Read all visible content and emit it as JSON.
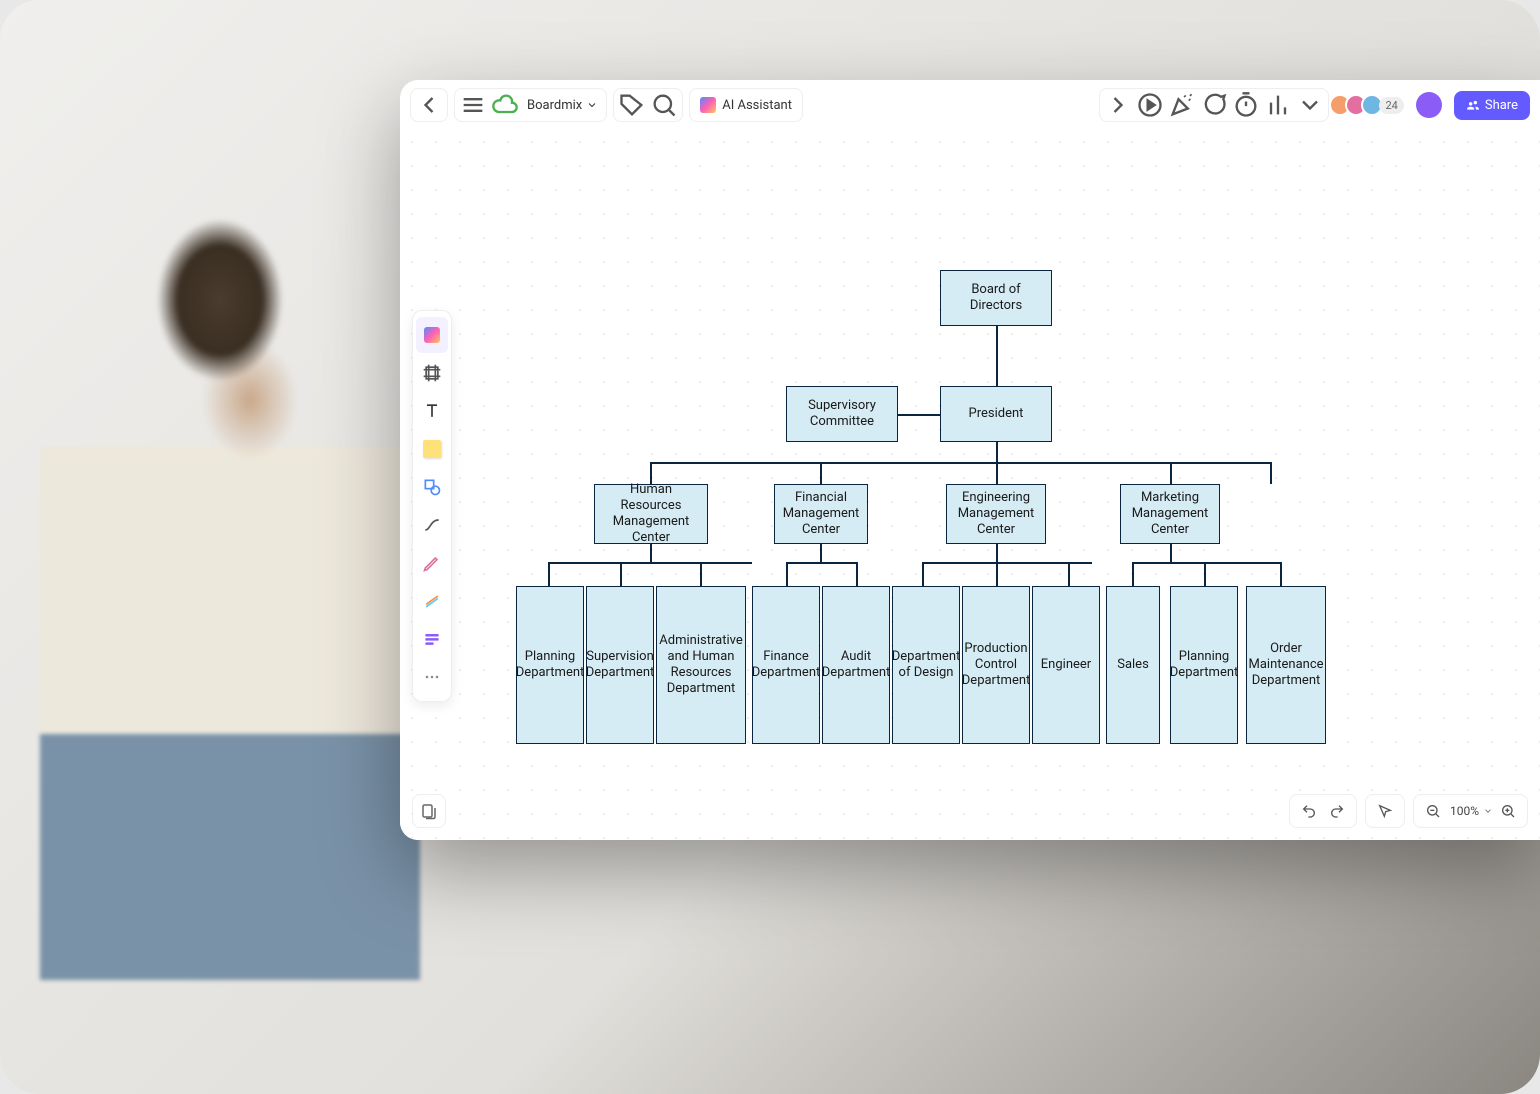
{
  "header": {
    "app_name": "Boardmix",
    "ai_label": "AI Assistant",
    "collaborator_count": "24",
    "share_label": "Share"
  },
  "left_tools": {
    "items": [
      "ai",
      "frame",
      "text",
      "sticky",
      "shape",
      "line",
      "pen",
      "highlighter",
      "mindmap",
      "more"
    ]
  },
  "footer": {
    "zoom": "100%"
  },
  "org": {
    "level1": "Board of Directors",
    "level2a": "Supervisory Committee",
    "level2b": "President",
    "level3": [
      "Human Resources Management Center",
      "Financial Management Center",
      "Engineering Management Center",
      "Marketing Management Center"
    ],
    "level4": [
      "Planning Department",
      "Supervision Department",
      "Administrative and Human Resources Department",
      "Finance Department",
      "Audit Department",
      "Department of Design",
      "Production Control Department",
      "Engineer",
      "Sales",
      "Planning Department",
      "Order Maintenance Department"
    ]
  }
}
